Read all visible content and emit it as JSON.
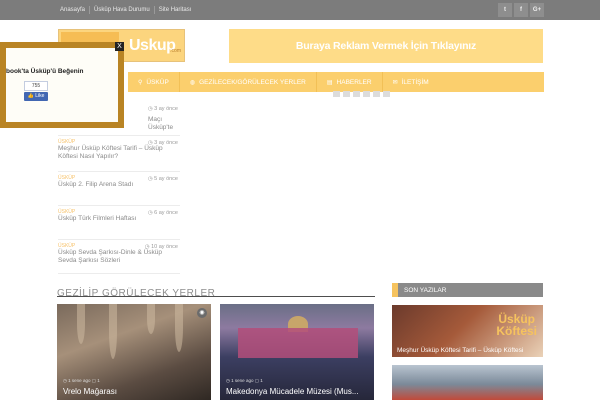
{
  "topbar": {
    "links": [
      "Anasayfa",
      "Üsküp Hava Durumu",
      "Site Haritası"
    ],
    "social": [
      {
        "icon": "twitter-icon",
        "glyph": "t"
      },
      {
        "icon": "facebook-icon",
        "glyph": "f"
      },
      {
        "icon": "google-plus-icon",
        "glyph": "G+"
      }
    ]
  },
  "logo": {
    "text": "Uskup",
    "domain": ".com"
  },
  "ad": {
    "text": "Buraya Reklam Vermek İçin Tıklayınız"
  },
  "nav": [
    {
      "label": "ÜSKÜP",
      "icon": "map-marker-icon",
      "glyph": "⚲"
    },
    {
      "label": "GEZİLECEK/GÖRÜLECEK YERLER",
      "icon": "globe-icon",
      "glyph": "◍"
    },
    {
      "label": "HABERLER",
      "icon": "newspaper-icon",
      "glyph": "▤"
    },
    {
      "label": "İLETİŞİM",
      "icon": "envelope-icon",
      "glyph": "✉"
    }
  ],
  "popup": {
    "title": "book'ta Üsküp'ü Beğenin",
    "count": "755",
    "like": "Like",
    "close": "X"
  },
  "posts": [
    {
      "cat": "",
      "time": "3 ay önce",
      "title": "Maçı Üsküp'te"
    },
    {
      "cat": "ÜSKÜP",
      "time": "3 ay önce",
      "title": "Meşhur Üsküp Köftesi Tarifi – Üsküp Köftesi Nasıl Yapılır?"
    },
    {
      "cat": "ÜSKÜP",
      "time": "5 ay önce",
      "title": "Üsküp 2. Filip Arena Stadı"
    },
    {
      "cat": "ÜSKÜP",
      "time": "6 ay önce",
      "title": "Üsküp Türk Filmleri Haftası"
    },
    {
      "cat": "ÜSKÜP",
      "time": "10 ay önce",
      "title": "Üsküp Sevda Şarkısı-Dinle & Üsküp Sevda Şarkısı Sözleri"
    }
  ],
  "sections": {
    "left": "GEZİLİP GÖRÜLECEK YERLER",
    "right": "SON YAZILAR"
  },
  "cards": [
    {
      "meta": "◷ 1 sene ago  ▢ 1",
      "title": "Vrelo Mağarası"
    },
    {
      "meta": "◷ 1 sene ago  ▢ 1",
      "title": "Makedonya Mücadele Müzesi (Mus..."
    }
  ],
  "sidebar": {
    "big_line1": "Üsküp",
    "big_line2": "Köftesi",
    "caption": "Meşhur Üsküp Köftesi Tarifi – Üsküp Köftesi"
  }
}
